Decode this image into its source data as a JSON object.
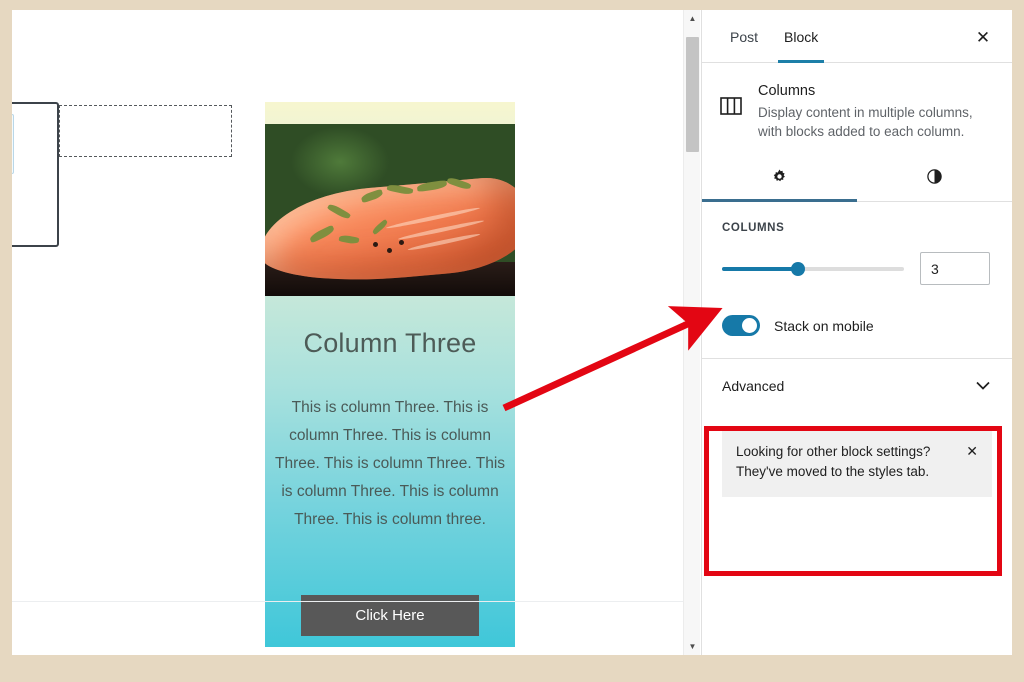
{
  "window": {
    "frame_color": "#e6d8c1"
  },
  "canvas": {
    "column_block": {
      "heading": "Column Three",
      "body": "This is column Three. This is column Three. This is column Three. This is column Three. This is column Three. This is column Three. This is column three.",
      "button_label": "Click Here",
      "image_alt": "grilled-salmon-photo",
      "gradient_top": "#f7f6cf",
      "gradient_bottom": "#3fc7d9",
      "button_bg": "#585858"
    },
    "scrollbar": {
      "up_arrow": "▲",
      "down_arrow": "▼"
    }
  },
  "sidebar": {
    "tabs": [
      {
        "id": "post",
        "label": "Post",
        "active": false
      },
      {
        "id": "block",
        "label": "Block",
        "active": true
      }
    ],
    "close_label": "✕",
    "block_card": {
      "icon": "columns-icon",
      "title": "Columns",
      "description": "Display content in multiple columns, with blocks added to each column."
    },
    "icon_tabs": [
      {
        "id": "settings",
        "icon": "gear-icon",
        "glyph": "✿",
        "active": true
      },
      {
        "id": "styles",
        "icon": "half-circle-contrast-icon",
        "glyph": "◐",
        "active": false
      }
    ],
    "columns_panel": {
      "label": "COLUMNS",
      "slider_value": 3,
      "slider_min": 1,
      "slider_max": 6,
      "slider_percent": 42,
      "number_value": "3",
      "toggle_label": "Stack on mobile",
      "toggle_on": true,
      "accent_color": "#1679a8"
    },
    "advanced": {
      "label": "Advanced",
      "chevron": "⌄"
    },
    "notice": {
      "text": "Looking for other block settings? They've moved to the styles tab.",
      "close_label": "✕"
    }
  },
  "annotations": {
    "highlight_color": "#e30613",
    "highlight_target": "columns-panel",
    "arrow_from": "column-body-text",
    "arrow_to": "columns-panel"
  }
}
